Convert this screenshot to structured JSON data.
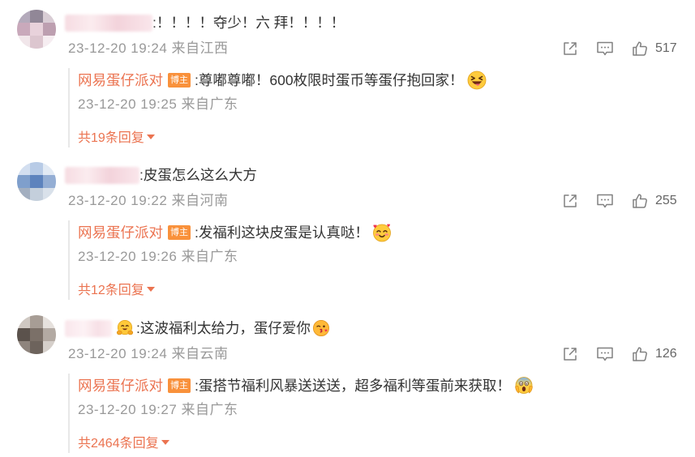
{
  "colors": {
    "background": "#ffffff",
    "text": "#333333",
    "meta": "#999999",
    "accent": "#eb7350",
    "badge_bg": "#f9913b",
    "badge_text": "#ffffff",
    "icon": "#808080",
    "count": "#666666",
    "reply_rule": "#e8e8e8"
  },
  "icons": {
    "share": "share-icon",
    "comment": "comment-icon",
    "like": "like-icon",
    "expand": "caret-down-icon"
  },
  "comments": [
    {
      "avatar_icon": "blurred-avatar",
      "text": ":！！！！夺少！六 拜！！！！",
      "meta": "23-12-20 19:24 来自江西",
      "likes": "517",
      "reply": {
        "author": "网易蛋仔派对",
        "badge": "博主",
        "text": ":尊嘟尊嘟！600枚限时蛋币等蛋仔抱回家！",
        "emoji_icon": "laughing-tongue-emoji",
        "meta": "23-12-20 19:25 来自广东",
        "more": "共19条回复"
      }
    },
    {
      "avatar_icon": "blurred-avatar",
      "text": ":皮蛋怎么这么大方",
      "meta": "23-12-20 19:22 来自河南",
      "likes": "255",
      "reply": {
        "author": "网易蛋仔派对",
        "badge": "博主",
        "text": ":发福利这块皮蛋是认真哒！",
        "emoji_icon": "heart-blush-emoji",
        "meta": "23-12-20 19:26 来自广东",
        "more": "共12条回复"
      }
    },
    {
      "avatar_icon": "blurred-avatar",
      "name_emoji_icon": "hugging-emoji",
      "text": ":这波福利太给力，蛋仔爱你",
      "text_emoji_icon": "kiss-emoji",
      "meta": "23-12-20 19:24 来自云南",
      "likes": "126",
      "reply": {
        "author": "网易蛋仔派对",
        "badge": "博主",
        "text": ":蛋搭节福利风暴送送送，超多福利等蛋前来获取！",
        "emoji_icon": "scream-emoji",
        "meta": "23-12-20 19:27 来自广东",
        "more": "共2464条回复"
      }
    }
  ]
}
